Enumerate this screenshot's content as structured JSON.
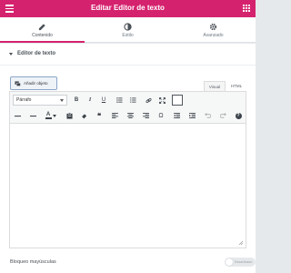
{
  "header": {
    "title": "Editar Editor de texto"
  },
  "tabs": [
    {
      "label": "Contenido",
      "icon": "pencil-icon",
      "active": true
    },
    {
      "label": "Estilo",
      "icon": "half-circle-icon",
      "active": false
    },
    {
      "label": "Avanzado",
      "icon": "gear-icon",
      "active": false
    }
  ],
  "section": {
    "title": "Editor de texto"
  },
  "media_button": {
    "label": "Añadir objeto"
  },
  "editor_tabs": {
    "visual": "Visual",
    "html": "HTML"
  },
  "format_select": {
    "value": "Párrafo"
  },
  "toolbar_row1": [
    "bold-icon",
    "italic-icon",
    "underline-icon",
    "bullet-list-icon",
    "numbered-list-icon",
    "link-icon",
    "fullscreen-icon"
  ],
  "toolbar_row2": [
    "horizontal-rule-icon",
    "strikethrough-icon",
    "text-color-icon",
    "paste-text-icon",
    "clear-formatting-icon",
    "blockquote-icon",
    "align-left-icon",
    "align-center-icon",
    "align-right-icon",
    "special-character-icon",
    "outdent-icon",
    "indent-icon",
    "undo-icon",
    "redo-icon",
    "help-icon"
  ],
  "toolbar_glyphs": {
    "bold": "B",
    "italic": "I",
    "underline": "U",
    "blockquote": "❝",
    "omega": "Ω",
    "help": "?"
  },
  "bottom": {
    "label": "Bloqueo mayúsculas",
    "toggle_text": "Desactivado"
  },
  "colors": {
    "brand": "#d5226e",
    "panel": "#ffffff",
    "background": "#e6e9ec"
  }
}
